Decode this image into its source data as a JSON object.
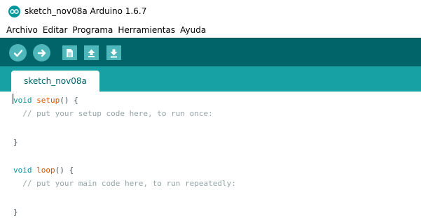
{
  "window": {
    "title": "sketch_nov08a Arduino 1.6.7",
    "icon": "arduino-logo-icon"
  },
  "menu": {
    "items": [
      "Archivo",
      "Editar",
      "Programa",
      "Herramientas",
      "Ayuda"
    ]
  },
  "toolbar": {
    "buttons": [
      {
        "name": "verify",
        "icon": "check-icon"
      },
      {
        "name": "upload",
        "icon": "arrow-right-icon"
      },
      {
        "name": "new",
        "icon": "new-file-icon"
      },
      {
        "name": "open",
        "icon": "arrow-up-icon"
      },
      {
        "name": "save",
        "icon": "arrow-down-icon"
      }
    ]
  },
  "tabs": [
    {
      "label": "sketch_nov08a"
    }
  ],
  "colors": {
    "toolbar": "#006468",
    "tabbar": "#17a1a5",
    "button": "#4db7bb",
    "keyword": "#00979c",
    "function": "#d35400",
    "comment": "#95a5a6"
  },
  "code": {
    "setup_kw": "void",
    "setup_fn": "setup",
    "setup_rest": "() {",
    "setup_comment": "  // put your setup code here, to run once:",
    "setup_close": "}",
    "loop_kw": "void",
    "loop_fn": "loop",
    "loop_rest": "() {",
    "loop_comment": "  // put your main code here, to run repeatedly:",
    "loop_close": "}"
  }
}
